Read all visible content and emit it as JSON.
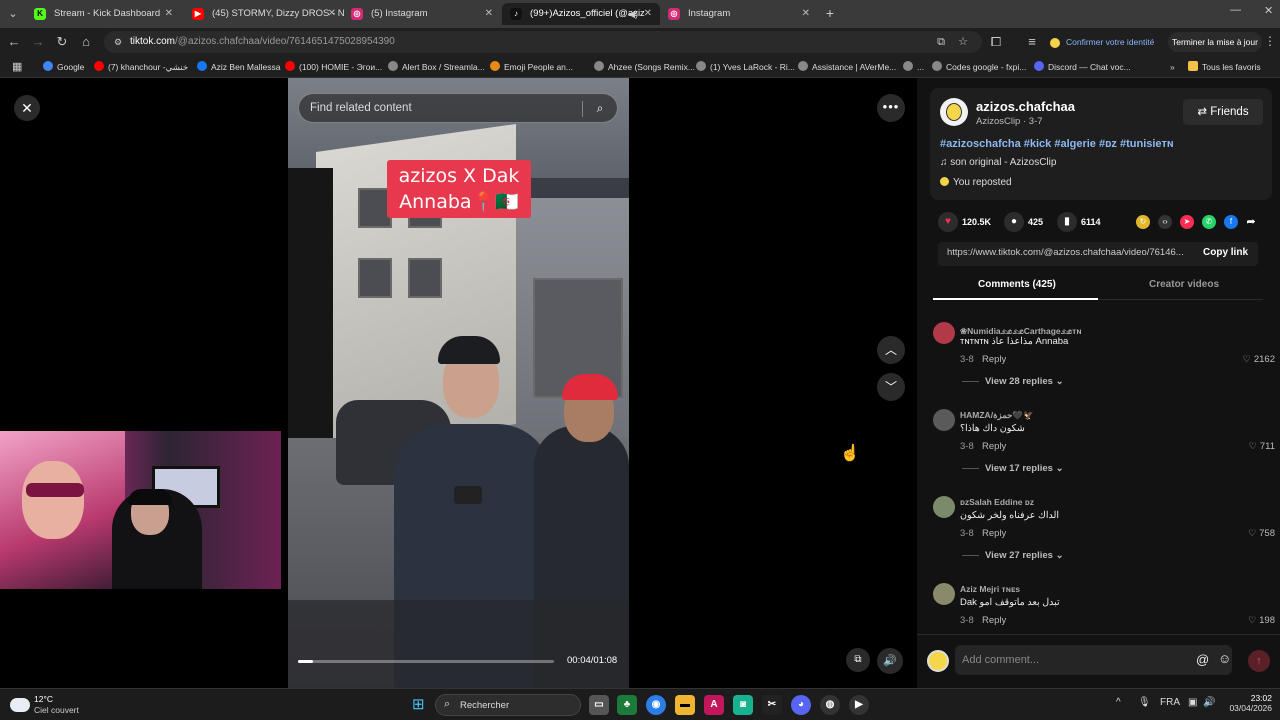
{
  "browser": {
    "tabs": [
      {
        "label": "Stream - Kick Dashboard",
        "favicon": "K",
        "favicon_color": "#53fc18"
      },
      {
        "label": "(45) STORMY, Dizzy DROS - N!",
        "favicon": "▶",
        "favicon_color": "#ff0000"
      },
      {
        "label": "(5) Instagram",
        "favicon": "◎",
        "favicon_color": "#d62976"
      },
      {
        "label": "(99+)Azizos_officiel (@aziz",
        "favicon": "♪",
        "favicon_color": "#111111"
      },
      {
        "label": "Instagram",
        "favicon": "◎",
        "favicon_color": "#d62976"
      }
    ],
    "active_tab": 3,
    "url_host": "tiktok.com",
    "url_path": "/@azizos.chafchaa/video/7614651475028954390",
    "identity_label": "Confirmer votre identité",
    "update_label": "Terminer la mise à jour",
    "bookmarks": [
      {
        "label": "Google",
        "color": "#4285f4"
      },
      {
        "label": "(7) khanchour -خنشي",
        "color": "#ff0000"
      },
      {
        "label": "Aziz Ben Mallessa",
        "color": "#1877f2"
      },
      {
        "label": "(100) HOMIE - Эгои...",
        "color": "#ff0000"
      },
      {
        "label": "Alert Box / Streamla...",
        "color": "#888888"
      },
      {
        "label": "Emoji People an...",
        "color": "#e88a1a"
      },
      {
        "label": "Ahzee (Songs Remix...",
        "color": "#888888"
      },
      {
        "label": "(1) Yves LaRock - Ri...",
        "color": "#888888"
      },
      {
        "label": "Assistance | AVerMe...",
        "color": "#888888"
      },
      {
        "label": "...",
        "color": "#888888"
      },
      {
        "label": "Codes google - fxpi...",
        "color": "#888888"
      },
      {
        "label": "Discord — Chat voc...",
        "color": "#5865f2"
      },
      {
        "label": "Tous les favoris",
        "color": "#f4c04a"
      }
    ]
  },
  "video": {
    "search_placeholder": "Find related content",
    "overlay_line1": "azizos X Dak",
    "overlay_line2": "Annaba📍🇩🇿",
    "time_current": "00:04",
    "time_total": "01:08",
    "time_display": "00:04/01:08",
    "progress_fraction": 0.0588
  },
  "panel": {
    "author_name": "azizos.chafchaa",
    "author_sub": "AzizosClip · 3-7",
    "friends_label": "Friends",
    "hashtags": "#azizoschafcha #kick #algerie #ᴅᴢ #tunisieᴛɴ",
    "sound": "son original - AzizosClip",
    "reposted": "You reposted",
    "stats": {
      "likes": "120.5K",
      "comments": "425",
      "saves": "6114"
    },
    "link": "https://www.tiktok.com/@azizos.chafchaa/video/76146...",
    "copy_label": "Copy link",
    "tab_comments": "Comments (425)",
    "tab_creator": "Creator videos",
    "add_comment_placeholder": "Add comment..."
  },
  "comments": [
    {
      "user": "❀Numidia𓃭𓃭Carthage𓃭ᴛɴ",
      "text": "ᴛɴᴛɴᴛɴ مذاعذا عاذ Annaba",
      "date": "3-8",
      "reply": "Reply",
      "likes": "2162",
      "view_replies": "View 28 replies",
      "avatar_color": "#b23a48"
    },
    {
      "user": "HAMZA/حمزة🖤🦅",
      "text": "شكون داك هاذا؟",
      "date": "3-8",
      "reply": "Reply",
      "likes": "711",
      "view_replies": "View 17 replies",
      "avatar_color": "#5a5a5a"
    },
    {
      "user": "ᴅᴢSalah Eddine ᴅᴢ",
      "text": "الداك عرفناه ولخر شكون",
      "date": "3-8",
      "reply": "Reply",
      "likes": "758",
      "view_replies": "View 27 replies",
      "avatar_color": "#7a8a6a"
    },
    {
      "user": "Aziz Mejri ᴛɴᴇs",
      "text": "Dak تبدل بعد ماتوقف امو",
      "date": "3-8",
      "reply": "Reply",
      "likes": "198",
      "view_replies": "",
      "avatar_color": "#8a8a6a"
    }
  ],
  "taskbar": {
    "temperature": "12°C",
    "weather": "Ciel couvert",
    "search_placeholder": "Rechercher",
    "language": "FRA",
    "time": "23:02",
    "date": "03/04/2026"
  }
}
